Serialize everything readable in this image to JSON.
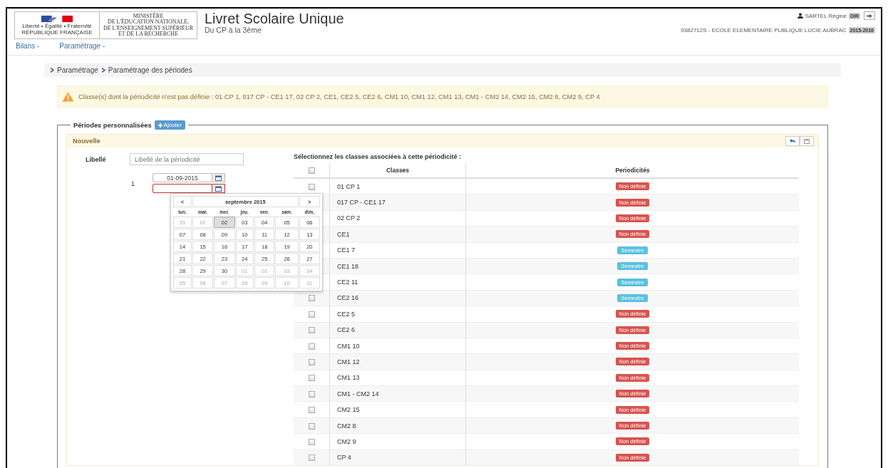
{
  "header": {
    "logo_lines": [
      "Liberté • Égalité • Fraternité",
      "RÉPUBLIQUE FRANÇAISE"
    ],
    "ministry_lines": [
      "MINISTÈRE",
      "DE L'ÉDUCATION NATIONALE,",
      "DE L'ENSEIGNEMENT SUPÉRIEUR",
      "ET DE LA RECHERCHE"
    ],
    "title": "Livret Scolaire Unique",
    "subtitle": "Du CP à la 3ème",
    "user": {
      "name": "SARTEL Régine",
      "role": "DIR"
    },
    "school": "0382712S - ECOLE ELEMENTAIRE PUBLIQUE LUCIE AUBRAC",
    "year": "2015-2016"
  },
  "menu": [
    "Bilans -",
    "Paramétrage -"
  ],
  "breadcrumb": [
    "Paramétrage",
    "Paramétrage des périodes"
  ],
  "alert": "Classe(s) dont la périodicité n'est pas définie : 01 CP 1, 017 CP - CE1 17, 02 CP 2, CE1, CE2 5, CE2 6, CM1 10, CM1 12, CM1 13, CM1 - CM2 14, CM2 15, CM2 8, CM2 9, CP 4",
  "periods": {
    "legend": "Périodes personnalisées",
    "add_button": "Ajouter",
    "panel": {
      "title": "Nouvelle",
      "label": "Libellé",
      "placeholder": "Libellé de la périodicité",
      "period_number": "1",
      "start_date": "01-09-2015",
      "end_date_invalid": true,
      "calendar": {
        "prev": "<",
        "next": ">",
        "month": "septembre 2015",
        "weekdays": [
          "lun.",
          "mar.",
          "mer.",
          "jeu.",
          "ven.",
          "sam.",
          "dim."
        ],
        "days": [
          {
            "label": "31",
            "muted": true,
            "selected": false
          },
          {
            "label": "01",
            "muted": true,
            "selected": false
          },
          {
            "label": "02",
            "muted": false,
            "selected": true
          },
          {
            "label": "03",
            "muted": false,
            "selected": false
          },
          {
            "label": "04",
            "muted": false,
            "selected": false
          },
          {
            "label": "05",
            "muted": false,
            "selected": false
          },
          {
            "label": "06",
            "muted": false,
            "selected": false
          },
          {
            "label": "07",
            "muted": false,
            "selected": false
          },
          {
            "label": "08",
            "muted": false,
            "selected": false
          },
          {
            "label": "09",
            "muted": false,
            "selected": false
          },
          {
            "label": "10",
            "muted": false,
            "selected": false
          },
          {
            "label": "11",
            "muted": false,
            "selected": false
          },
          {
            "label": "12",
            "muted": false,
            "selected": false
          },
          {
            "label": "13",
            "muted": false,
            "selected": false
          },
          {
            "label": "14",
            "muted": false,
            "selected": false
          },
          {
            "label": "15",
            "muted": false,
            "selected": false
          },
          {
            "label": "16",
            "muted": false,
            "selected": false
          },
          {
            "label": "17",
            "muted": false,
            "selected": false
          },
          {
            "label": "18",
            "muted": false,
            "selected": false
          },
          {
            "label": "19",
            "muted": false,
            "selected": false
          },
          {
            "label": "20",
            "muted": false,
            "selected": false
          },
          {
            "label": "21",
            "muted": false,
            "selected": false
          },
          {
            "label": "22",
            "muted": false,
            "selected": false
          },
          {
            "label": "23",
            "muted": false,
            "selected": false
          },
          {
            "label": "24",
            "muted": false,
            "selected": false
          },
          {
            "label": "25",
            "muted": false,
            "selected": false
          },
          {
            "label": "26",
            "muted": false,
            "selected": false
          },
          {
            "label": "27",
            "muted": false,
            "selected": false
          },
          {
            "label": "28",
            "muted": false,
            "selected": false
          },
          {
            "label": "29",
            "muted": false,
            "selected": false
          },
          {
            "label": "30",
            "muted": false,
            "selected": false
          },
          {
            "label": "01",
            "muted": true,
            "selected": false
          },
          {
            "label": "02",
            "muted": true,
            "selected": false
          },
          {
            "label": "03",
            "muted": true,
            "selected": false
          },
          {
            "label": "04",
            "muted": true,
            "selected": false
          },
          {
            "label": "05",
            "muted": true,
            "selected": false
          },
          {
            "label": "06",
            "muted": true,
            "selected": false
          },
          {
            "label": "07",
            "muted": true,
            "selected": false
          },
          {
            "label": "08",
            "muted": true,
            "selected": false
          },
          {
            "label": "09",
            "muted": true,
            "selected": false
          },
          {
            "label": "10",
            "muted": true,
            "selected": false
          },
          {
            "label": "11",
            "muted": true,
            "selected": false
          }
        ]
      },
      "instruction": "Sélectionnez les classes associées à cette périodicité :",
      "table": {
        "columns": [
          "Classes",
          "Periodicités"
        ],
        "all_checked": false,
        "rows": [
          {
            "name": "01 CP 1",
            "checked": false,
            "periodicity": "Non définie",
            "kind": "undefined"
          },
          {
            "name": "017 CP - CE1 17",
            "periodicity": "Non définie",
            "kind": "undefined"
          },
          {
            "name": "02 CP 2",
            "periodicity": "Non définie",
            "kind": "undefined"
          },
          {
            "name": "CE1",
            "periodicity": "Non définie",
            "kind": "undefined"
          },
          {
            "name": "CE1 7",
            "periodicity": "Semestre",
            "kind": "semester"
          },
          {
            "name": "CE1 18",
            "periodicity": "Semestre",
            "kind": "semester"
          },
          {
            "name": "CE2 11",
            "periodicity": "Semestre",
            "kind": "semester"
          },
          {
            "name": "CE2 16",
            "checked": false,
            "periodicity": "Semestre",
            "kind": "semester"
          },
          {
            "name": "CE2 5",
            "checked": false,
            "periodicity": "Non définie",
            "kind": "undefined"
          },
          {
            "name": "CE2 6",
            "checked": false,
            "periodicity": "Non définie",
            "kind": "undefined"
          },
          {
            "name": "CM1 10",
            "checked": false,
            "periodicity": "Non définie",
            "kind": "undefined"
          },
          {
            "name": "CM1 12",
            "checked": false,
            "periodicity": "Non définie",
            "kind": "undefined"
          },
          {
            "name": "CM1 13",
            "checked": false,
            "periodicity": "Non définie",
            "kind": "undefined"
          },
          {
            "name": "CM1 - CM2 14",
            "checked": false,
            "periodicity": "Non définie",
            "kind": "undefined"
          },
          {
            "name": "CM2 15",
            "checked": false,
            "periodicity": "Non définie",
            "kind": "undefined"
          },
          {
            "name": "CM2 8",
            "checked": false,
            "periodicity": "Non définie",
            "kind": "undefined"
          },
          {
            "name": "CM2 9",
            "checked": false,
            "periodicity": "Non définie",
            "kind": "undefined"
          },
          {
            "name": "CP 4",
            "checked": false,
            "periodicity": "Non définie",
            "kind": "undefined"
          }
        ]
      }
    }
  }
}
